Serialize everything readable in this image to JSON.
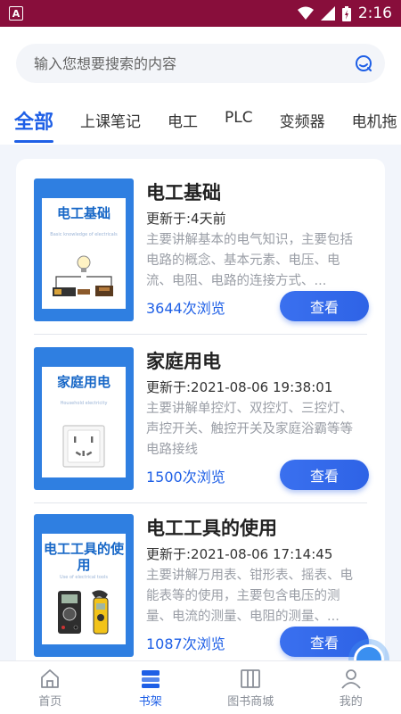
{
  "status_bar": {
    "left_icon_letter": "A",
    "time": "2:16"
  },
  "search": {
    "placeholder": "输入您想要搜索的内容"
  },
  "tabs": [
    "全部",
    "上课笔记",
    "电工",
    "PLC",
    "变频器",
    "电机拖"
  ],
  "books": [
    {
      "cover_title": "电工基础",
      "cover_subtitle": "Basic knowledge of electricals",
      "title": "电工基础",
      "updated": "更新于:4天前",
      "description": "主要讲解基本的电气知识，主要包括电路的概念、基本元素、电压、电流、电阻、电路的连接方式、...",
      "views": "3644次浏览",
      "button_label": "查看",
      "cover_icon": "circuit-bulb-icon"
    },
    {
      "cover_title": "家庭用电",
      "cover_subtitle": "Household electricity",
      "title": "家庭用电",
      "updated": "更新于:2021-08-06 19:38:01",
      "description": "主要讲解单控灯、双控灯、三控灯、声控开关、触控开关及家庭浴霸等等电路接线",
      "views": "1500次浏览",
      "button_label": "查看",
      "cover_icon": "wall-socket-icon"
    },
    {
      "cover_title": "电工工具的使用",
      "cover_subtitle": "Use of electrical tools",
      "title": "电工工具的使用",
      "updated": "更新于:2021-08-06 17:14:45",
      "description": "主要讲解万用表、钳形表、摇表、电能表等的使用，主要包含电压的测量、电流的测量、电阻的测量、...",
      "views": "1087次浏览",
      "button_label": "查看",
      "cover_icon": "multimeter-icon"
    }
  ],
  "bottom_nav": [
    {
      "label": "首页",
      "icon": "home-icon"
    },
    {
      "label": "书架",
      "icon": "bookshelf-icon"
    },
    {
      "label": "图书商城",
      "icon": "bookstore-icon"
    },
    {
      "label": "我的",
      "icon": "profile-icon"
    }
  ],
  "colors": {
    "accent": "#1e5fe6",
    "status_bar": "#880e3b",
    "cover_blue": "#2f7fe1"
  }
}
